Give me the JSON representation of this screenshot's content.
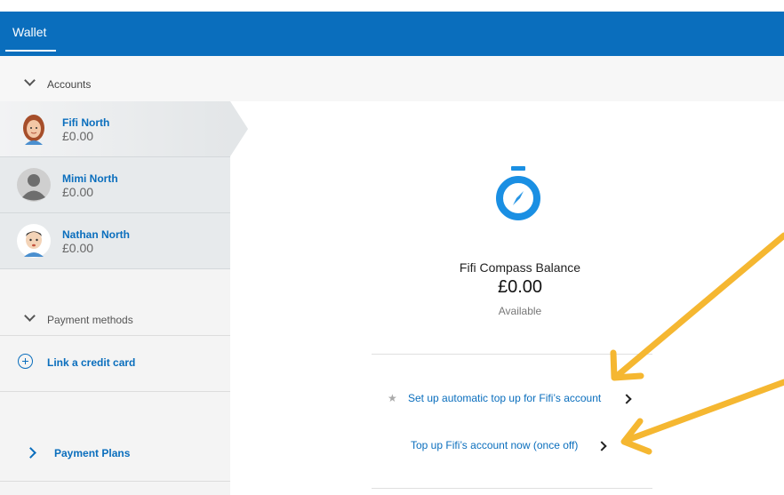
{
  "header": {
    "tab_label": "Wallet"
  },
  "accounts_section": {
    "label": "Accounts"
  },
  "accounts": [
    {
      "name": "Fifi North",
      "balance": "£0.00",
      "selected": true
    },
    {
      "name": "Mimi North",
      "balance": "£0.00",
      "selected": false
    },
    {
      "name": "Nathan North",
      "balance": "£0.00",
      "selected": false
    }
  ],
  "payment_methods": {
    "label": "Payment methods",
    "link_card_label": "Link a credit card"
  },
  "payment_plans": {
    "label": "Payment Plans"
  },
  "main": {
    "icon": "compass-stopwatch-icon",
    "title": "Fifi Compass Balance",
    "amount": "£0.00",
    "status": "Available",
    "actions": [
      {
        "label": "Set up automatic top up for Fifi’s account",
        "icon": "star-icon"
      },
      {
        "label": "Top up Fifi’s account now (once off)"
      }
    ]
  },
  "colors": {
    "brand": "#0a6ebd",
    "compass": "#1a8fe3",
    "annotation_arrow": "#f5b731"
  },
  "annotations": [
    "arrow-pointing-automatic-top-up",
    "arrow-pointing-top-up-now"
  ]
}
